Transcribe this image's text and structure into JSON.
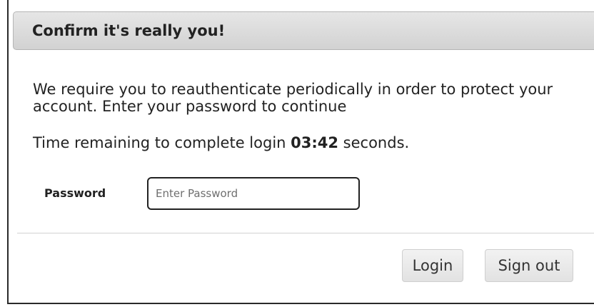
{
  "dialog": {
    "title": "Confirm it's really you!",
    "message": "We require you to reauthenticate periodically in order to protect your account. Enter your password to continue",
    "timer_prefix": "Time remaining to complete login ",
    "timer_value": "03:42",
    "timer_suffix": " seconds."
  },
  "form": {
    "password_label": "Password",
    "password_placeholder": "Enter Password",
    "password_value": ""
  },
  "actions": {
    "login_label": "Login",
    "signout_label": "Sign out"
  }
}
